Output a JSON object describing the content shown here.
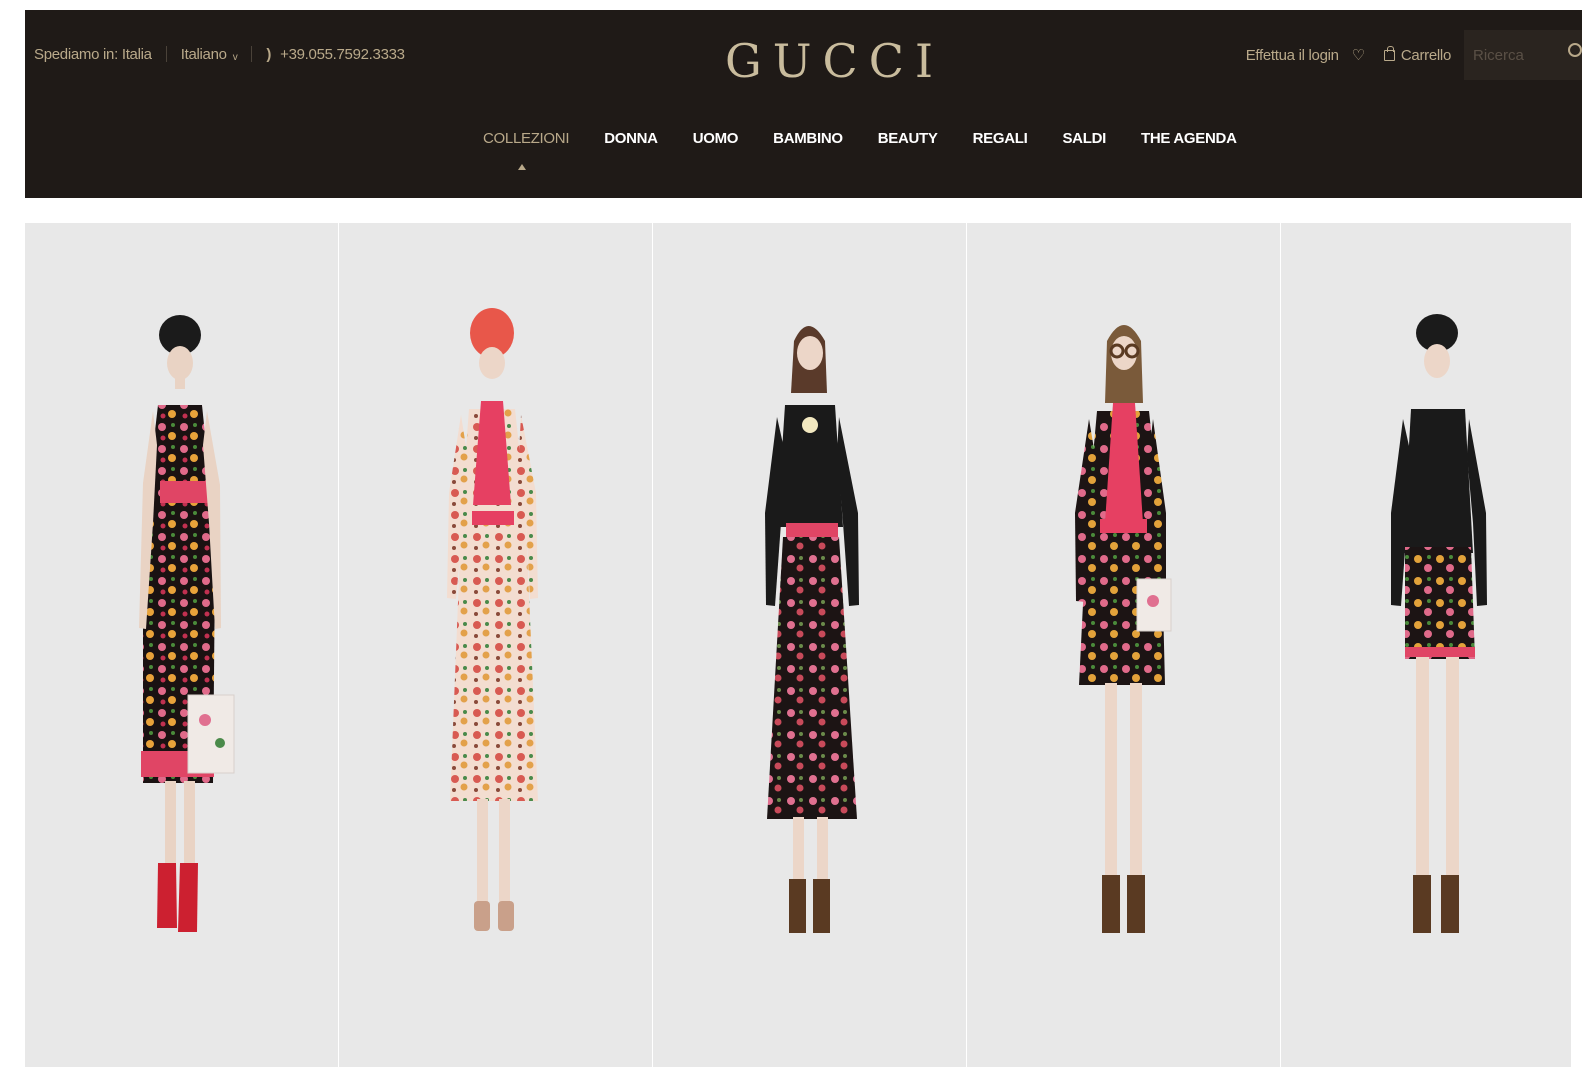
{
  "header": {
    "ship_label": "Spediamo in: Italia",
    "language": "Italiano",
    "phone": "+39.055.7592.3333",
    "logo": "GUCCI",
    "login": "Effettua il login",
    "cart": "Carrello",
    "search_placeholder": "Ricerca"
  },
  "nav": {
    "items": [
      {
        "label": "COLLEZIONI"
      },
      {
        "label": "DONNA"
      },
      {
        "label": "UOMO"
      },
      {
        "label": "BAMBINO"
      },
      {
        "label": "BEAUTY"
      },
      {
        "label": "REGALI"
      },
      {
        "label": "SALDI"
      },
      {
        "label": "THE AGENDA"
      }
    ]
  },
  "looks": [
    {
      "id": "look-1",
      "icon": "model-floral-black-dress"
    },
    {
      "id": "look-2",
      "icon": "model-floral-cream-dress"
    },
    {
      "id": "look-3",
      "icon": "model-black-shirt-floral-skirt"
    },
    {
      "id": "look-4",
      "icon": "model-floral-pussybow-dress"
    },
    {
      "id": "look-5",
      "icon": "model-black-shirt-floral-shorts"
    }
  ],
  "colors": {
    "header_bg": "#1f1a17",
    "gold": "#b9a98a",
    "tile_bg": "#e8e8e8"
  }
}
